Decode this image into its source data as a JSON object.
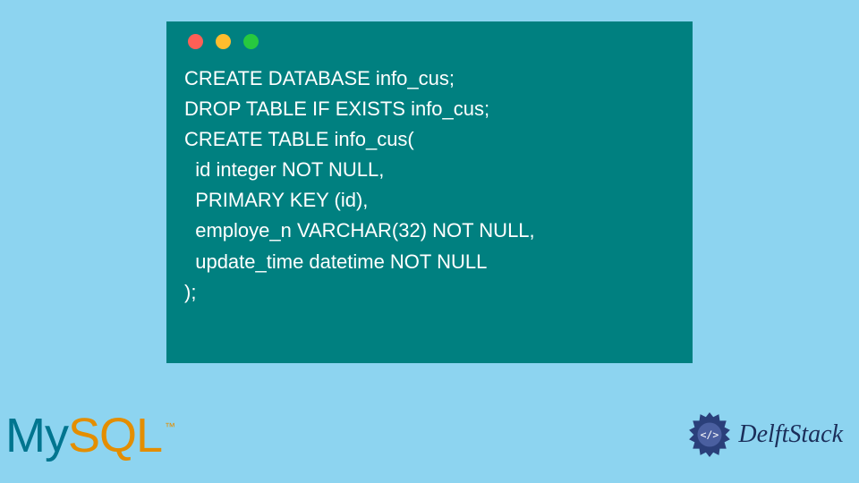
{
  "code": {
    "lines": [
      "CREATE DATABASE info_cus;",
      "DROP TABLE IF EXISTS info_cus;",
      "CREATE TABLE info_cus(",
      "  id integer NOT NULL,",
      "  PRIMARY KEY (id),",
      "  employe_n VARCHAR(32) NOT NULL,",
      "  update_time datetime NOT NULL",
      ");"
    ]
  },
  "traffic_colors": {
    "red": "#ff5f56",
    "yellow": "#ffbd2e",
    "green": "#27c93f"
  },
  "logo_mysql": {
    "part1": "My",
    "part2": "SQL",
    "tm": "™"
  },
  "logo_delft": {
    "text": "DelftStack"
  }
}
